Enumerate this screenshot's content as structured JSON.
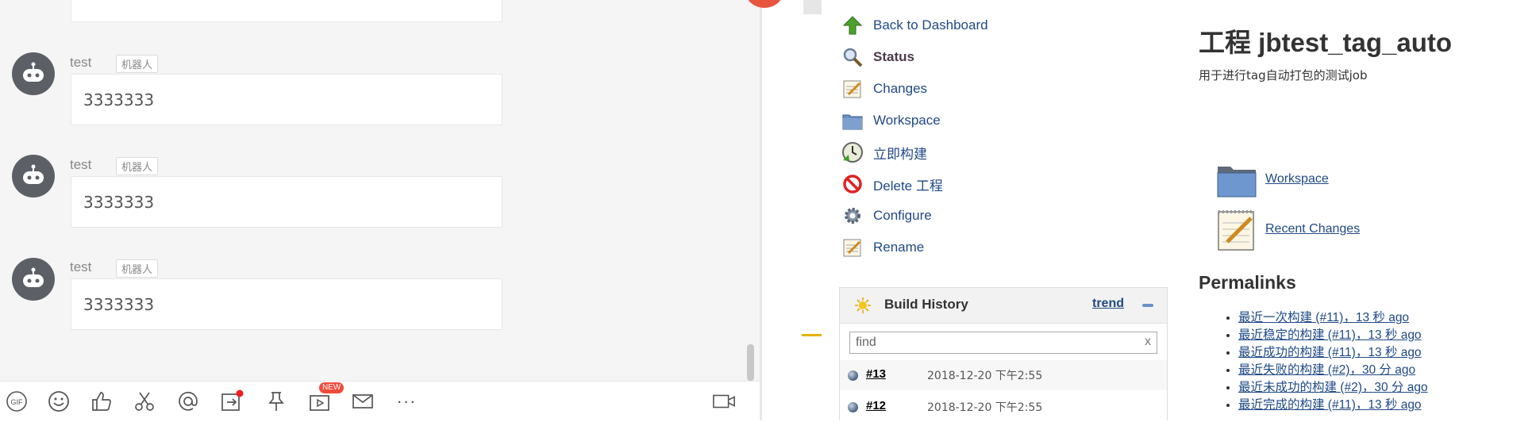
{
  "chat": {
    "messages": [
      {
        "sender": "test",
        "tag": "机器人",
        "text": "3333333"
      },
      {
        "sender": "test",
        "tag": "机器人",
        "text": "3333333"
      },
      {
        "sender": "test",
        "tag": "机器人",
        "text": "3333333"
      }
    ],
    "toolbar": {
      "icons": [
        "gif-icon",
        "emoji-icon",
        "thumbs-up-icon",
        "scissors-icon",
        "at-icon",
        "share-icon",
        "pin-icon",
        "video-icon",
        "mail-icon",
        "more-icon",
        "camera-icon"
      ],
      "new_badge": "NEW",
      "gif_label": "GIF",
      "more_label": "···"
    }
  },
  "jenkins": {
    "tasks": [
      {
        "label": "Back to Dashboard",
        "icon": "up-arrow-icon"
      },
      {
        "label": "Status",
        "icon": "search-icon"
      },
      {
        "label": "Changes",
        "icon": "notepad-icon"
      },
      {
        "label": "Workspace",
        "icon": "folder-icon"
      },
      {
        "label": "立即构建",
        "icon": "clock-icon"
      },
      {
        "label": "Delete 工程",
        "icon": "no-entry-icon"
      },
      {
        "label": "Configure",
        "icon": "gear-icon"
      },
      {
        "label": "Rename",
        "icon": "notepad-icon"
      }
    ],
    "build_history": {
      "title": "Build History",
      "trend_label": "trend",
      "find_placeholder": "find",
      "clear_label": "x",
      "builds": [
        {
          "number": "#13",
          "time": "2018-12-20 下午2:55"
        },
        {
          "number": "#12",
          "time": "2018-12-20 下午2:55"
        }
      ]
    },
    "job_title": "工程 jbtest_tag_auto",
    "job_description": "用于进行tag自动打包的测试job",
    "links": [
      {
        "label": "Workspace",
        "icon": "folder-icon"
      },
      {
        "label": "Recent Changes",
        "icon": "notepad-icon"
      }
    ],
    "permalinks_title": "Permalinks",
    "permalinks": [
      "最近一次构建 (#11)，13 秒 ago",
      "最近稳定的构建 (#11)，13 秒 ago",
      "最近成功的构建 (#11)，13 秒 ago",
      "最近失败的构建 (#2)，30 分 ago",
      "最近未成功的构建 (#2)，30 分 ago",
      "最近完成的构建 (#11)，13 秒 ago"
    ]
  },
  "colors": {
    "link": "#204a87",
    "badge_red": "#f04b3c",
    "avatar_gray": "#5c6066"
  }
}
